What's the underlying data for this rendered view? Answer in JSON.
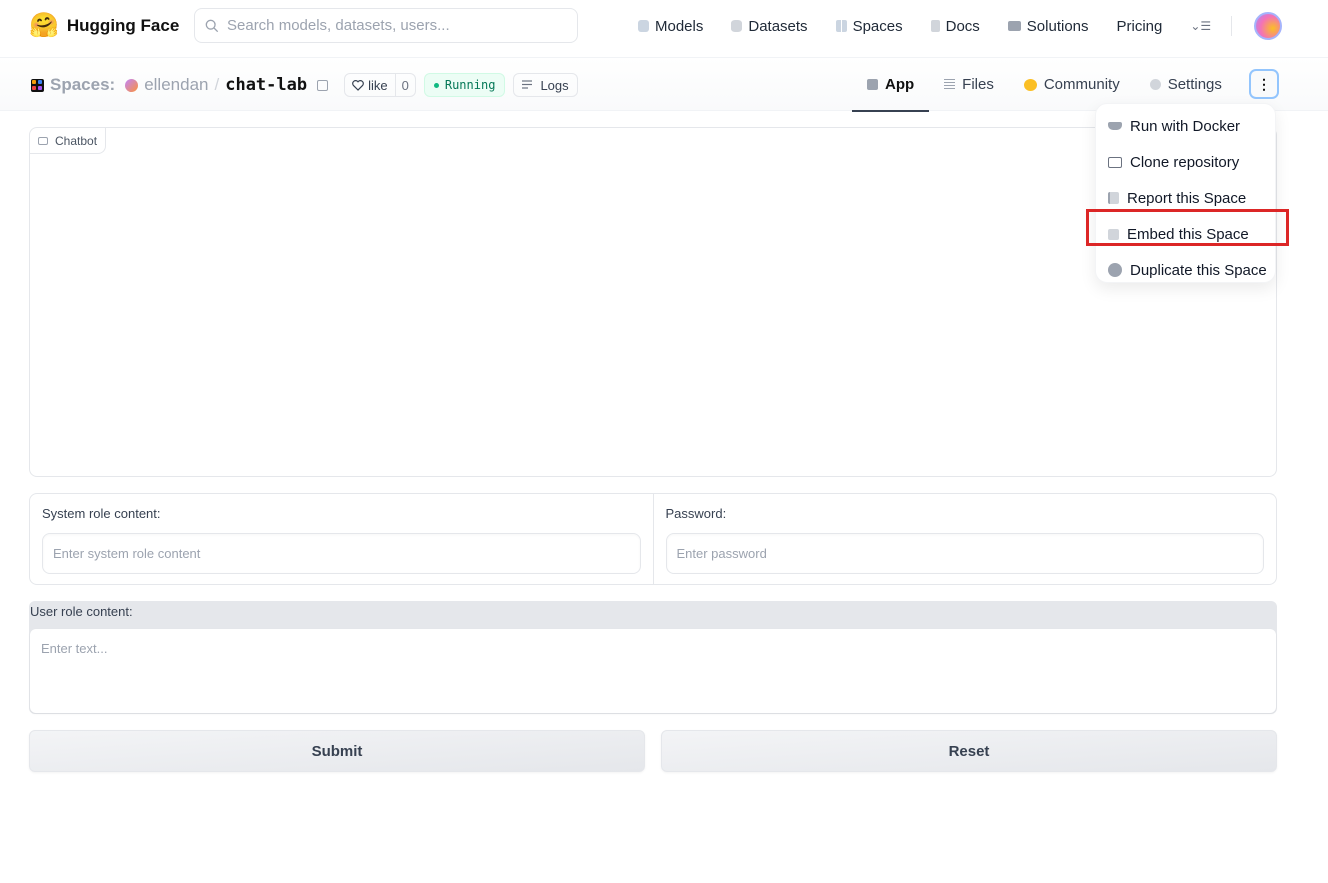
{
  "header": {
    "logo_emoji": "🤗",
    "brand": "Hugging Face",
    "search_placeholder": "Search models, datasets, users...",
    "nav": [
      {
        "label": "Models",
        "icon": "cube-icon"
      },
      {
        "label": "Datasets",
        "icon": "database-icon"
      },
      {
        "label": "Spaces",
        "icon": "grid-icon"
      },
      {
        "label": "Docs",
        "icon": "document-icon"
      },
      {
        "label": "Solutions",
        "icon": "briefcase-icon"
      },
      {
        "label": "Pricing",
        "icon": null
      }
    ],
    "more_glyph": "⌄☰"
  },
  "subheader": {
    "section": "Spaces:",
    "owner": "ellendan",
    "separator": "/",
    "repo": "chat-lab",
    "like_label": "like",
    "like_count": "0",
    "status": "Running",
    "logs_label": "Logs",
    "tabs": [
      {
        "label": "App",
        "active": true
      },
      {
        "label": "Files",
        "active": false
      },
      {
        "label": "Community",
        "active": false
      },
      {
        "label": "Settings",
        "active": false
      }
    ],
    "kebab_glyph": "⋮"
  },
  "dropdown_menu": {
    "items": [
      {
        "label": "Run with Docker",
        "icon": "docker-icon"
      },
      {
        "label": "Clone repository",
        "icon": "terminal-icon"
      },
      {
        "label": "Report this Space",
        "icon": "flag-icon"
      },
      {
        "label": "Embed this Space",
        "icon": "embed-icon",
        "highlighted": true
      },
      {
        "label": "Duplicate this Space",
        "icon": "duplicate-icon"
      }
    ],
    "highlight_color": "#dc2626"
  },
  "app": {
    "chatbot_label": "Chatbot",
    "system_label": "System role content:",
    "system_placeholder": "Enter system role content",
    "system_value": "",
    "password_label": "Password:",
    "password_placeholder": "Enter password",
    "password_value": "",
    "user_label": "User role content:",
    "user_placeholder": "Enter text...",
    "user_value": "",
    "submit_label": "Submit",
    "reset_label": "Reset"
  }
}
